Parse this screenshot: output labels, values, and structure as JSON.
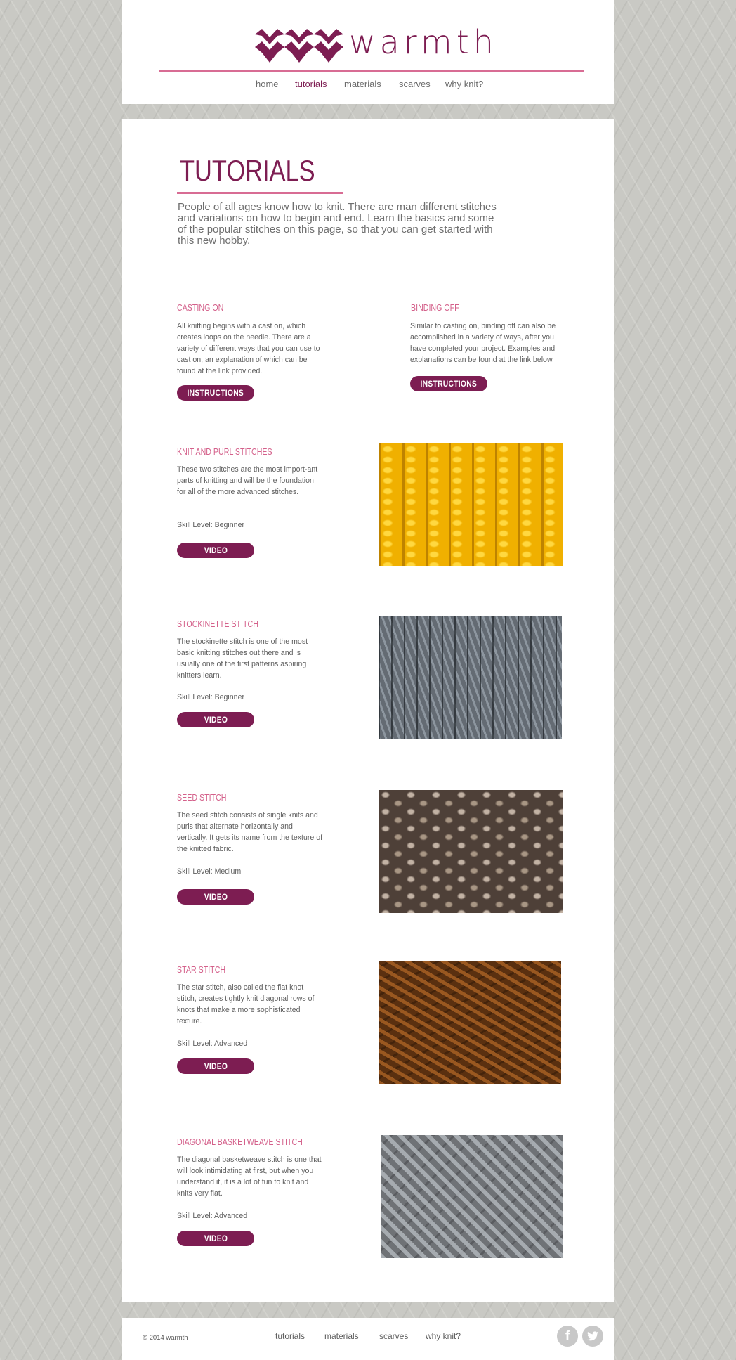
{
  "brand": {
    "name": "warmth",
    "primary_color": "#7d1d52",
    "accent_color": "#d86c94"
  },
  "nav": {
    "items": [
      {
        "label": "home",
        "active": false
      },
      {
        "label": "tutorials",
        "active": true
      },
      {
        "label": "materials",
        "active": false
      },
      {
        "label": "scarves",
        "active": false
      },
      {
        "label": "why knit?",
        "active": false
      }
    ]
  },
  "page": {
    "title": "TUTORIALS",
    "intro": "People of all ages know how to knit. There are man different stitches and variations on how to begin and end. Learn the basics and some of the popular stitches on this page, so that you can get started with this new hobby."
  },
  "basics": [
    {
      "title": "CASTING ON",
      "body": "All knitting begins with a cast on, which creates loops on the needle. There are a variety of different ways that you can use to cast on, an explanation of which can be found at the link provided.",
      "button": "INSTRUCTIONS"
    },
    {
      "title": "BINDING OFF",
      "body": "Similar to casting on, binding off can also be accomplished in a variety of ways, after you have completed your project. Examples and explanations can be found at the link below.",
      "button": "INSTRUCTIONS"
    }
  ],
  "stitches": [
    {
      "title": "KNIT AND PURL STITCHES",
      "body": "These two stitches are the most import-ant parts of knitting and will be the foundation for all of the more advanced stitches.",
      "skill": "Skill Level: Beginner",
      "button": "VIDEO",
      "image": "yellow-knit-swatch"
    },
    {
      "title": "STOCKINETTE STITCH",
      "body": "The stockinette stitch is one of the most basic knitting stitches out there and is usually one of the first patterns aspiring knitters learn.",
      "skill": "Skill Level: Beginner",
      "button": "VIDEO",
      "image": "grey-stockinette-swatch"
    },
    {
      "title": "SEED STITCH",
      "body": "The seed stitch consists of single knits and purls that alternate horizontally and vertically. It gets its name from the texture of the knitted fabric.",
      "skill": "Skill Level: Medium",
      "button": "VIDEO",
      "image": "seed-stitch-swatch"
    },
    {
      "title": "STAR STITCH",
      "body": "The star stitch, also called the flat knot stitch, creates tightly knit diagonal rows of knots that make a more sophisticated texture.",
      "skill": "Skill Level: Advanced",
      "button": "VIDEO",
      "image": "brown-star-stitch-swatch"
    },
    {
      "title": "DIAGONAL BASKETWEAVE STITCH",
      "body": "The diagonal basketweave stitch is one that will look intimidating at first, but when you understand it, it is a lot of fun to knit and knits very flat.",
      "skill": "Skill Level: Advanced",
      "button": "VIDEO",
      "image": "grey-basketweave-swatch"
    }
  ],
  "footer": {
    "copyright": "© 2014 warmth",
    "nav": [
      "tutorials",
      "materials",
      "scarves",
      "why knit?"
    ],
    "social": [
      "facebook-icon",
      "twitter-icon"
    ]
  }
}
